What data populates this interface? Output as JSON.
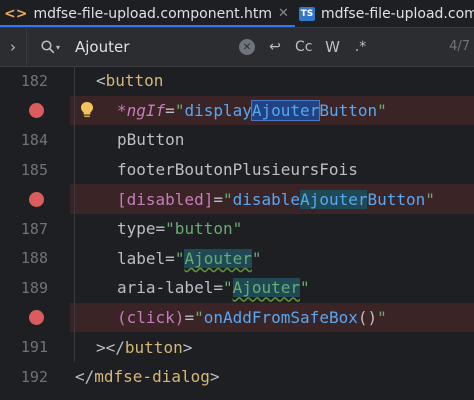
{
  "tabs": [
    {
      "label": "mdfse-file-upload.component.htm",
      "icon": "html-file-icon",
      "active": true
    },
    {
      "label": "mdfse-file-upload.componen",
      "icon": "ts-file-icon",
      "active": false
    }
  ],
  "find": {
    "query": "Ajouter",
    "regex_label": ".*",
    "match_case_label": "Cc",
    "words_label": "W",
    "count": "4/7"
  },
  "editor": {
    "lines": [
      {
        "number": "182",
        "breakpoint": false
      },
      {
        "number": "183",
        "breakpoint": true
      },
      {
        "number": "184",
        "breakpoint": false
      },
      {
        "number": "185",
        "breakpoint": false
      },
      {
        "number": "186",
        "breakpoint": true
      },
      {
        "number": "187",
        "breakpoint": false
      },
      {
        "number": "188",
        "breakpoint": false
      },
      {
        "number": "189",
        "breakpoint": false
      },
      {
        "number": "190",
        "breakpoint": true
      },
      {
        "number": "191",
        "breakpoint": false
      },
      {
        "number": "192",
        "breakpoint": false
      }
    ],
    "code": {
      "l182": {
        "open": "<",
        "tag": "button"
      },
      "l183": {
        "attr": "*ngIf",
        "eq": "=",
        "q1": "\"",
        "pre": "display",
        "match": "Ajouter",
        "post": "Button",
        "q2": "\""
      },
      "l184": {
        "attr": "pButton"
      },
      "l185": {
        "attr": "footerBoutonPlusieursFois"
      },
      "l186": {
        "attr": "[disabled]",
        "eq": "=",
        "q1": "\"",
        "pre": "disable",
        "match": "Ajouter",
        "post": "Button",
        "q2": "\""
      },
      "l187": {
        "attr": "type",
        "eq": "=",
        "value": "\"button\""
      },
      "l188": {
        "attr": "label",
        "eq": "=",
        "q1": "\"",
        "match": "Ajouter",
        "q2": "\""
      },
      "l189": {
        "attr": "aria-label",
        "eq": "=",
        "q1": "\"",
        "match": "Ajouter",
        "q2": "\""
      },
      "l190": {
        "attr": "(click)",
        "eq": "=",
        "q1": "\"",
        "expr": "onAddFromSafeBox",
        "paren": "()",
        "q2": "\""
      },
      "l191": {
        "close": "></",
        "tag": "button",
        "end": ">"
      },
      "l192": {
        "open": "</",
        "tag": "mdfse-dialog",
        "end": ">"
      }
    }
  }
}
